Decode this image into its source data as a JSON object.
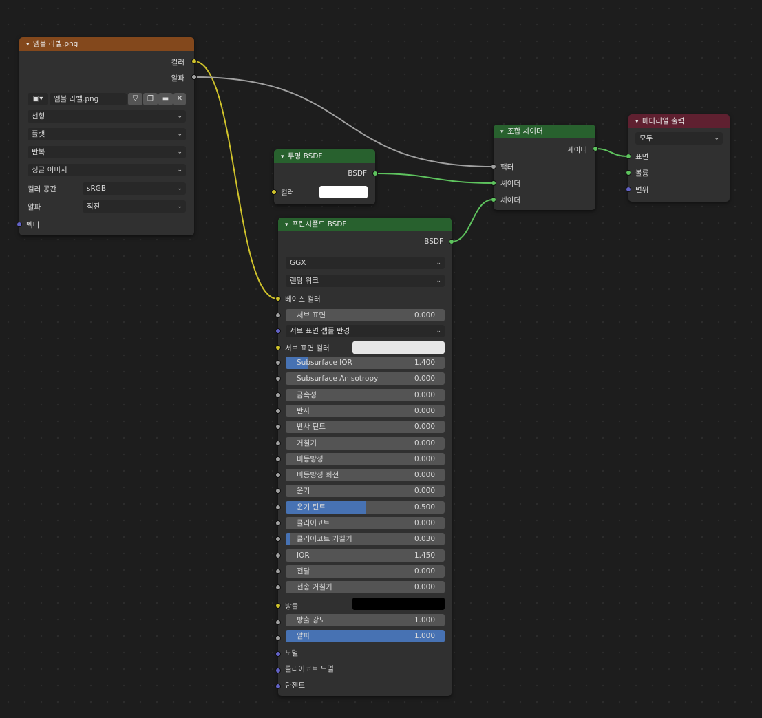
{
  "image_node": {
    "title": "엠블 라벨.png",
    "out_color": "컬러",
    "out_alpha": "알파",
    "image_name": "엠블 라벨.png",
    "image_icon": "image-icon",
    "dropdowns": [
      "선형",
      "플랫",
      "반복",
      "싱글 이미지"
    ],
    "colorspace_label": "컬러 공간",
    "colorspace_value": "sRGB",
    "alpha_label": "알파",
    "alpha_value": "직진",
    "in_vector": "벡터"
  },
  "transparent_node": {
    "title": "투명 BSDF",
    "out_bsdf": "BSDF",
    "in_color": "컬러",
    "color_value": "#ffffff"
  },
  "mix_node": {
    "title": "조합 셰이더",
    "out_shader": "셰이더",
    "in_factor": "팩터",
    "in_shader1": "셰이더",
    "in_shader2": "셰이더"
  },
  "output_node": {
    "title": "매테리얼 출력",
    "target": "모두",
    "in_surface": "표면",
    "in_volume": "볼륨",
    "in_displacement": "변위"
  },
  "principled_node": {
    "title": "프린시플드 BSDF",
    "out_bsdf": "BSDF",
    "distribution": "GGX",
    "subsurface_method": "랜덤 워크",
    "base_color_label": "베이스 컬러",
    "subsurface_label": "서브 표면",
    "subsurface_value": "0.000",
    "subsurface_radius_label": "서브 표면 셈플 반경",
    "subsurface_color_label": "서브 표면 컬러",
    "subsurface_color": "#e6e6e6",
    "sliders": [
      {
        "label": "Subsurface IOR",
        "value": "1.400",
        "fill": 0.14
      },
      {
        "label": "Subsurface Anisotropy",
        "value": "0.000",
        "fill": 0
      },
      {
        "label": "금속성",
        "value": "0.000",
        "fill": 0
      },
      {
        "label": "반사",
        "value": "0.000",
        "fill": 0
      },
      {
        "label": "반사 틴트",
        "value": "0.000",
        "fill": 0
      },
      {
        "label": "거칠기",
        "value": "0.000",
        "fill": 0
      },
      {
        "label": "비등방성",
        "value": "0.000",
        "fill": 0
      },
      {
        "label": "비등방성 회전",
        "value": "0.000",
        "fill": 0
      },
      {
        "label": "윤기",
        "value": "0.000",
        "fill": 0
      },
      {
        "label": "윤기 틴트",
        "value": "0.500",
        "fill": 0.5
      },
      {
        "label": "클리어코트",
        "value": "0.000",
        "fill": 0
      },
      {
        "label": "클리어코트 거칠기",
        "value": "0.030",
        "fill": 0.03
      },
      {
        "label": "IOR",
        "value": "1.450",
        "fill": 0
      },
      {
        "label": "전달",
        "value": "0.000",
        "fill": 0
      },
      {
        "label": "전송 거칠기",
        "value": "0.000",
        "fill": 0
      }
    ],
    "emission_label": "방출",
    "emission_color": "#000000",
    "emission_strength": {
      "label": "방출 강도",
      "value": "1.000",
      "fill": 0
    },
    "alpha": {
      "label": "알파",
      "value": "1.000",
      "fill": 1.0
    },
    "normal_label": "노멀",
    "clearcoat_normal_label": "클리어코트 노멀",
    "tangent_label": "탄젠트"
  },
  "colors": {
    "socket_color": "#cfc22b",
    "socket_float": "#a1a1a1",
    "socket_shader": "#5ec35e",
    "socket_vector": "#6363c7",
    "link_color": "#cfc22b",
    "link_float": "#a1a1a1",
    "link_shader": "#5ec35e"
  }
}
